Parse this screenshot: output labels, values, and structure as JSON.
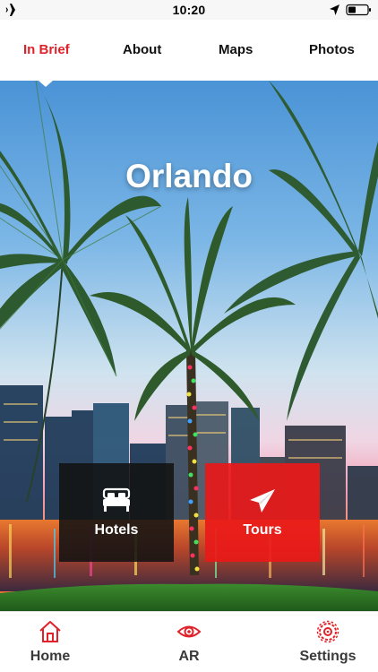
{
  "status_bar": {
    "time": "10:20",
    "icons": [
      "airplane-icon",
      "location-arrow-icon",
      "battery-icon"
    ]
  },
  "tabs": [
    {
      "label": "In Brief",
      "active": true
    },
    {
      "label": "About",
      "active": false
    },
    {
      "label": "Maps",
      "active": false
    },
    {
      "label": "Photos",
      "active": false
    }
  ],
  "hero": {
    "title": "Orlando",
    "tiles": [
      {
        "label": "Hotels",
        "icon": "bed-icon"
      },
      {
        "label": "Tours",
        "icon": "paper-plane-icon"
      }
    ]
  },
  "bottom_nav": [
    {
      "label": "Home",
      "icon": "house-icon"
    },
    {
      "label": "AR",
      "icon": "eye-icon"
    },
    {
      "label": "Settings",
      "icon": "gear-icon"
    }
  ],
  "colors": {
    "accent": "#e0222a",
    "tours_tile": "#e91919",
    "hotels_tile": "#121212"
  }
}
